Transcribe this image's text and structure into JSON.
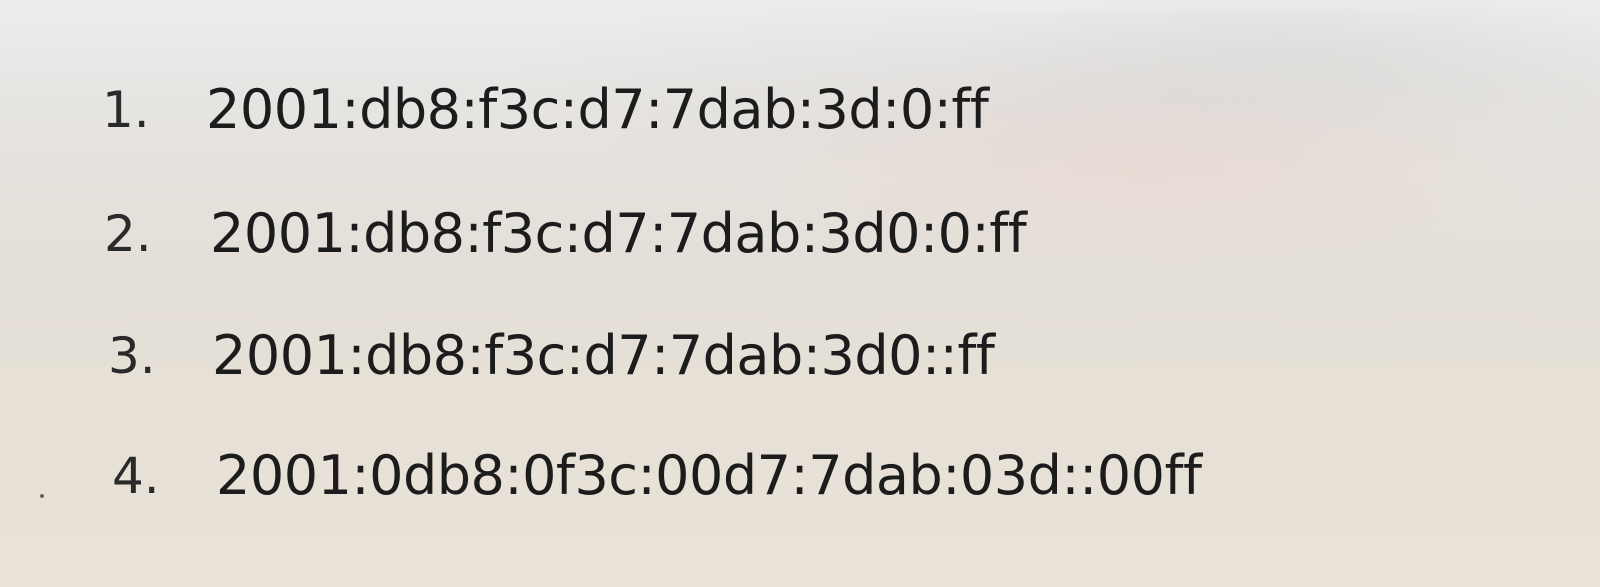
{
  "list": {
    "items": [
      {
        "number": "1.",
        "address": "2001:db8:f3c:d7:7dab:3d:0:ff"
      },
      {
        "number": "2.",
        "address": "2001:db8:f3c:d7:7dab:3d0:0:ff"
      },
      {
        "number": "3.",
        "address": "2001:db8:f3c:d7:7dab:3d0::ff"
      },
      {
        "number": "4.",
        "address": "2001:0db8:0f3c:00d7:7dab:03d::00ff"
      }
    ]
  }
}
